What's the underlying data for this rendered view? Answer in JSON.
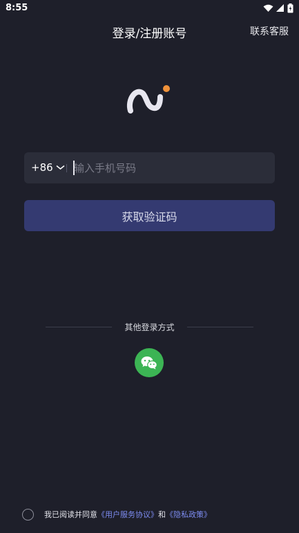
{
  "status_bar": {
    "time": "8:55"
  },
  "header": {
    "title": "登录/注册账号",
    "support": "联系客服"
  },
  "phone": {
    "country_code": "+86",
    "placeholder": "输入手机号码",
    "value": ""
  },
  "buttons": {
    "get_code": "获取验证码"
  },
  "other_login": {
    "label": "其他登录方式",
    "methods": [
      "wechat"
    ]
  },
  "agreement": {
    "prefix": "我已阅读并同意",
    "user_agreement": "《用户服务协议》",
    "and": "和",
    "privacy_policy": "《隐私政策》",
    "checked": false
  },
  "colors": {
    "background": "#1e1f2a",
    "input_bg": "#2b2d39",
    "primary_button": "#343a71",
    "link": "#7d8cf1",
    "wechat": "#3cb454",
    "logo_dot": "#f0923a"
  }
}
